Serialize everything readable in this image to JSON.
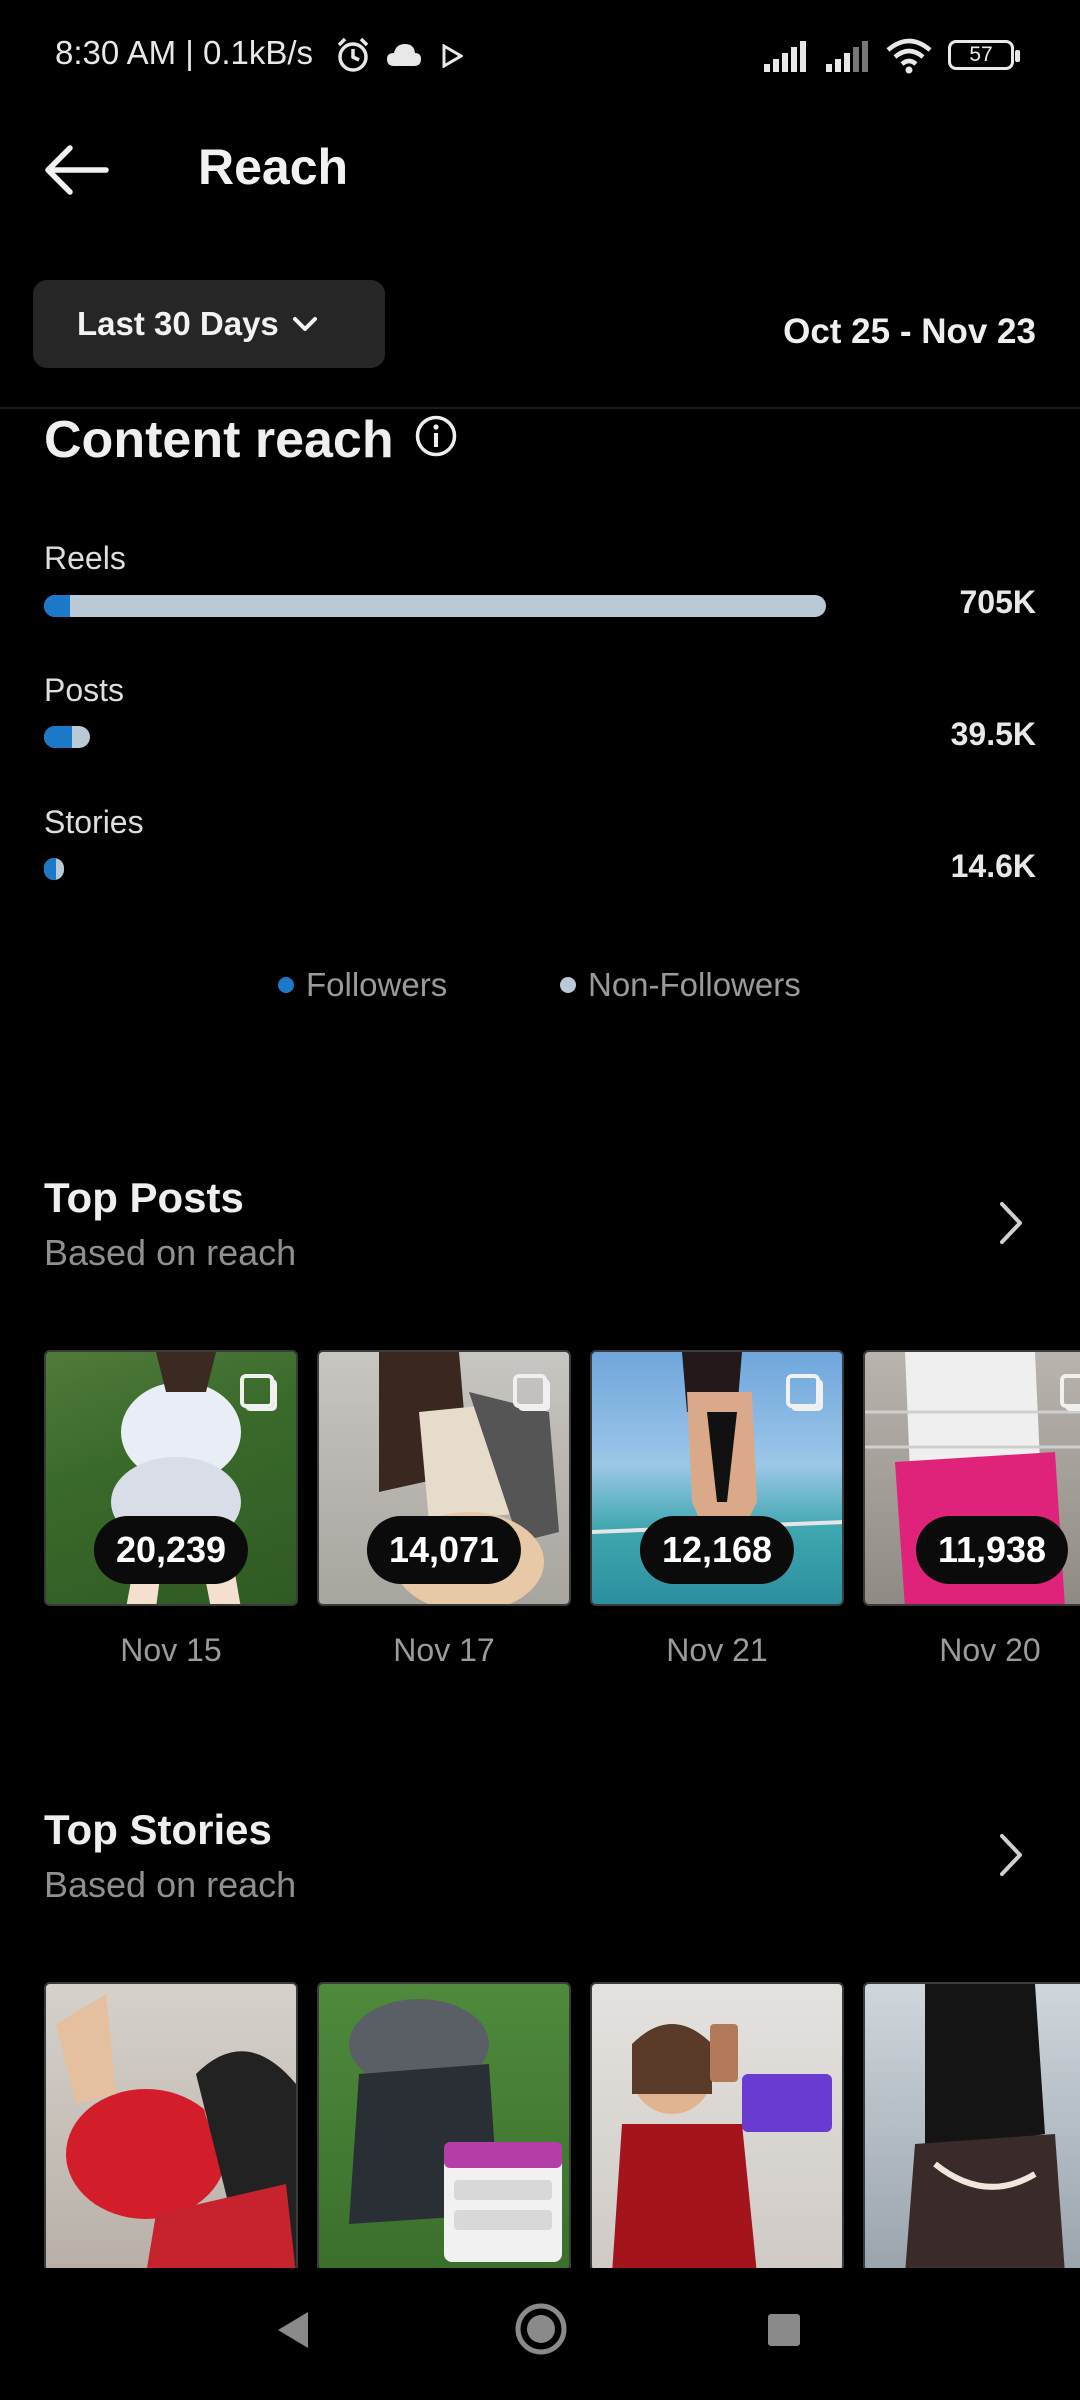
{
  "status_bar": {
    "text": "8:30 AM | 0.1kB/s",
    "battery": "57",
    "icons": [
      "alarm-icon",
      "cloud-icon",
      "play-icon",
      "signal-icon",
      "signal-icon",
      "wifi-icon",
      "battery-icon"
    ]
  },
  "header": {
    "title": "Reach",
    "period_label": "Last 30 Days",
    "date_range": "Oct 25 - Nov 23"
  },
  "content_reach": {
    "title": "Content reach",
    "rows": [
      {
        "label": "Reels",
        "value": "705K",
        "followers_fraction": 0.035
      },
      {
        "label": "Posts",
        "value": "39.5K",
        "followers_fraction": 0.6
      },
      {
        "label": "Stories",
        "value": "14.6K",
        "followers_fraction": 0.6
      }
    ],
    "legend": {
      "followers": "Followers",
      "non_followers": "Non-Followers"
    },
    "colors": {
      "followers": "#1c79c8",
      "non_followers": "#b9c9d6"
    }
  },
  "top_posts": {
    "title": "Top Posts",
    "subtitle": "Based on reach",
    "items": [
      {
        "count": "20,239",
        "date": "Nov 15"
      },
      {
        "count": "14,071",
        "date": "Nov 17"
      },
      {
        "count": "12,168",
        "date": "Nov 21"
      },
      {
        "count": "11,938",
        "date": "Nov 20"
      }
    ]
  },
  "top_stories": {
    "title": "Top Stories",
    "subtitle": "Based on reach"
  }
}
